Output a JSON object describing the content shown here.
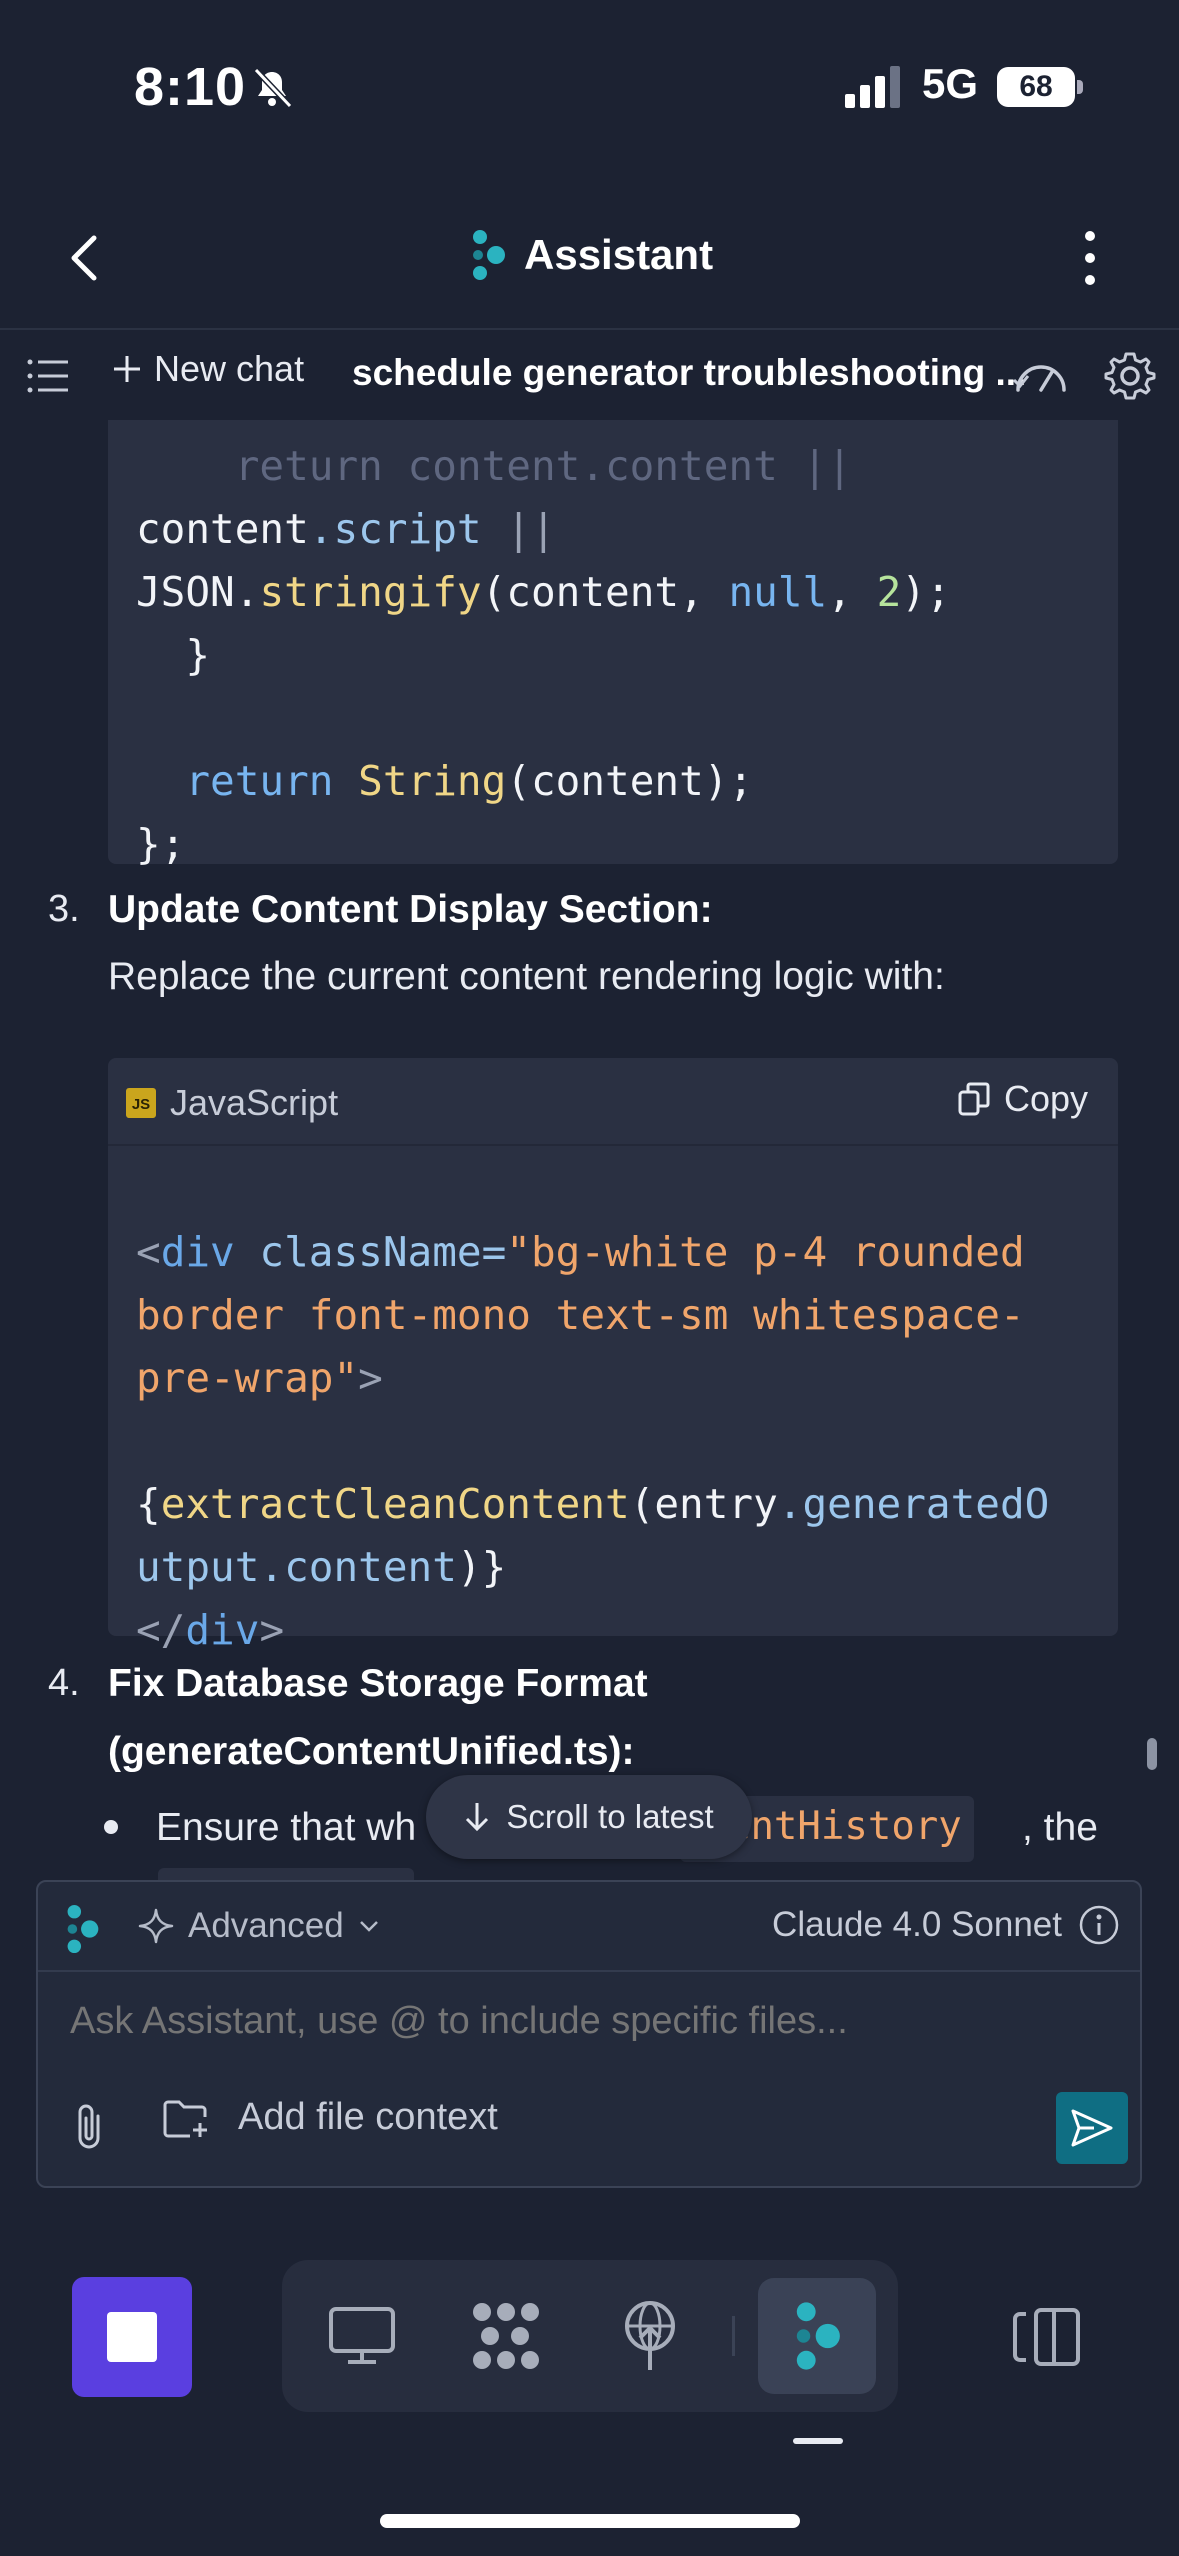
{
  "status": {
    "time": "8:10",
    "network": "5G",
    "battery": "68"
  },
  "header": {
    "title": "Assistant"
  },
  "toolbar": {
    "new_chat": "New chat",
    "chat_title": "schedule generator troubleshooting ..."
  },
  "code_block_1": {
    "faded_line": "    return content.content ||",
    "line2_a": "content",
    "line2_b": ".script",
    "line2_c": " ||",
    "line3_a": "JSON",
    "line3_b": ".",
    "line3_c": "stringify",
    "line3_d": "(content, ",
    "line3_e": "null",
    "line3_f": ", ",
    "line3_g": "2",
    "line3_h": ");",
    "line4": "  }",
    "line6_a": "  ",
    "line6_b": "return",
    "line6_c": " ",
    "line6_d": "String",
    "line6_e": "(content);",
    "line7": "};"
  },
  "step3": {
    "number": "3.",
    "title": "Update Content Display Section:",
    "text": "Replace the current content rendering logic with:"
  },
  "code_block_2": {
    "language": "JavaScript",
    "badge": "JS",
    "copy_label": "Copy",
    "l1_a": "<",
    "l1_b": "div",
    "l1_c": " className=",
    "l1_d": "\"bg-white p-4 rounded",
    "l2": "border font-mono text-sm whitespace-",
    "l3_a": "pre-wrap\"",
    "l3_b": ">",
    "l5_a": "{",
    "l5_b": "extractCleanContent",
    "l5_c": "(entry",
    "l5_d": ".generatedO",
    "l6_a": "utput",
    "l6_b": ".content",
    "l6_c": ")}",
    "l7_a": "</",
    "l7_b": "div",
    "l7_c": ">"
  },
  "step4": {
    "number": "4.",
    "title_line1": "Fix Database Storage Format",
    "title_line2": "(generateContentUnified.ts):",
    "bullet_start": "Ensure that wh",
    "bullet_code": "ntentHistory",
    "bullet_end": ", the"
  },
  "scroll_latest": "Scroll to latest",
  "composer": {
    "mode": "Advanced",
    "model": "Claude 4.0 Sonnet",
    "placeholder": "Ask Assistant, use @ to include specific files...",
    "add_context": "Add file context"
  },
  "colors": {
    "background": "#1c2232",
    "code_bg": "#2a3042",
    "accent_teal": "#0f6e83",
    "stop_purple": "#5a3fe0"
  }
}
